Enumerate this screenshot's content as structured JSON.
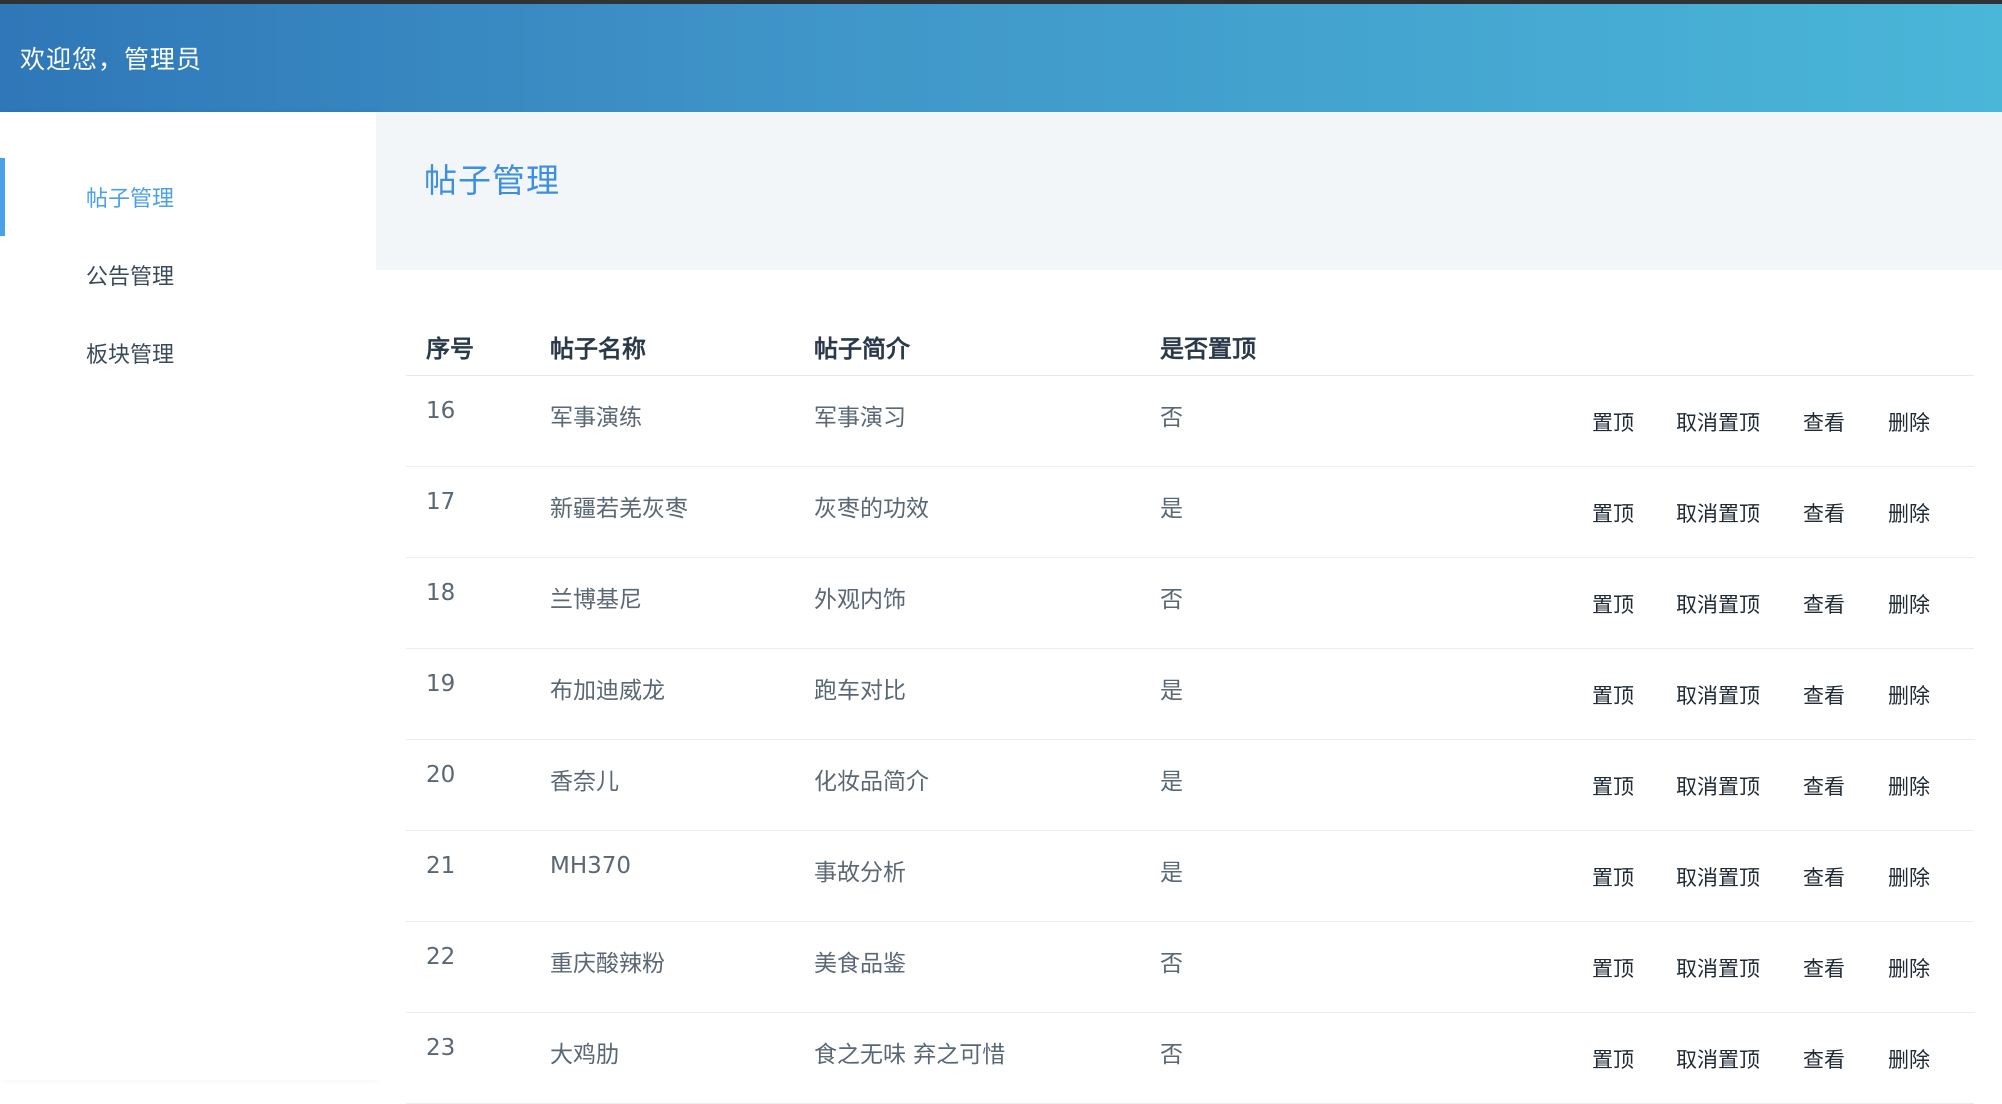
{
  "header": {
    "welcome": "欢迎您，管理员",
    "colors": {
      "gradient_start": "#2f77b8",
      "gradient_end": "#4ab6d8"
    }
  },
  "sidebar": {
    "items": [
      {
        "label": "帖子管理",
        "active": true
      },
      {
        "label": "公告管理",
        "active": false
      },
      {
        "label": "板块管理",
        "active": false
      }
    ],
    "accent_color": "#4aa1e8"
  },
  "main": {
    "title": "帖子管理",
    "table": {
      "columns": [
        "序号",
        "帖子名称",
        "帖子简介",
        "是否置顶"
      ],
      "action_labels": {
        "pin": "置顶",
        "unpin": "取消置顶",
        "view": "查看",
        "delete": "删除"
      },
      "rows": [
        {
          "id": "16",
          "name": "军事演练",
          "desc": "军事演习",
          "pinned": "否"
        },
        {
          "id": "17",
          "name": "新疆若羌灰枣",
          "desc": "灰枣的功效",
          "pinned": "是"
        },
        {
          "id": "18",
          "name": "兰博基尼",
          "desc": "外观内饰",
          "pinned": "否"
        },
        {
          "id": "19",
          "name": "布加迪威龙",
          "desc": "跑车对比",
          "pinned": "是"
        },
        {
          "id": "20",
          "name": "香奈儿",
          "desc": "化妆品简介",
          "pinned": "是"
        },
        {
          "id": "21",
          "name": "MH370",
          "desc": "事故分析",
          "pinned": "是"
        },
        {
          "id": "22",
          "name": "重庆酸辣粉",
          "desc": "美食品鉴",
          "pinned": "否"
        },
        {
          "id": "23",
          "name": "大鸡肋",
          "desc": "食之无味 弃之可惜",
          "pinned": "否"
        }
      ]
    }
  }
}
